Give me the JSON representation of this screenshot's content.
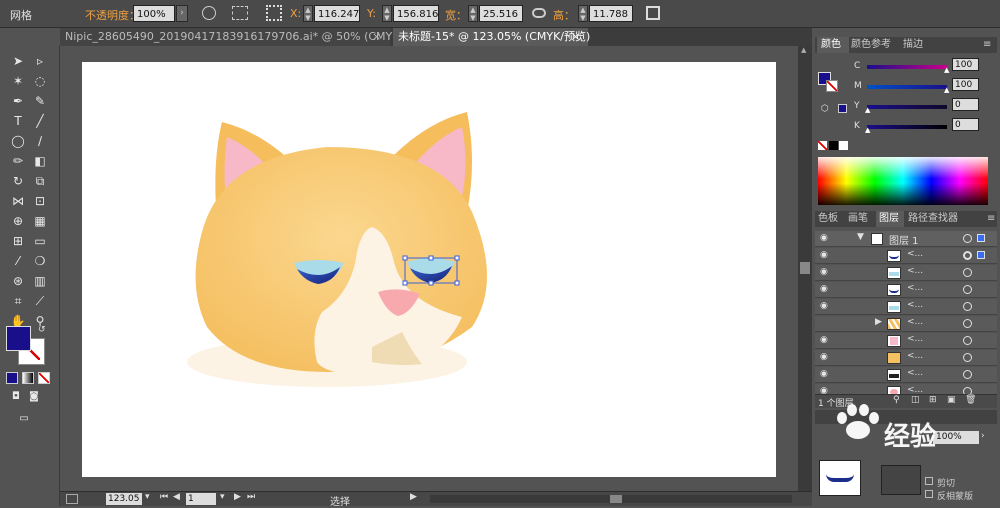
{
  "control_bar": {
    "mode_label": "网格",
    "opacity_label": "不透明度：",
    "opacity_value": "100%",
    "x_label": "X:",
    "x_value": "116.247",
    "y_label": "Y:",
    "y_value": "156.816",
    "w_label": "宽：",
    "w_value": "25.516",
    "h_label": "高：",
    "h_value": "11.788"
  },
  "tabs": [
    {
      "label": "Nipic_28605490_20190417183916179706.ai* @ 50% (CMYK/预览)",
      "active": false
    },
    {
      "label": "未标题-15* @ 123.05% (CMYK/预览)",
      "active": true
    }
  ],
  "color_panel": {
    "tabs": [
      "颜色",
      "颜色参考",
      "描边"
    ],
    "channels": [
      {
        "name": "C",
        "value": "100"
      },
      {
        "name": "M",
        "value": "100"
      },
      {
        "name": "Y",
        "value": "0"
      },
      {
        "name": "K",
        "value": "0"
      }
    ]
  },
  "layers_panel": {
    "tabs": [
      "色板",
      "画笔",
      "图层",
      "路径查找器"
    ],
    "layer_name": "图层 1",
    "sublayer_label": "<...",
    "footer_count": "1 个图层"
  },
  "transparency_panel": {
    "opacity_value": "100%",
    "clip_label": "剪切",
    "invert_label": "反相蒙版"
  },
  "status_bar": {
    "zoom": "123.05",
    "page": "1",
    "tool": "选择"
  },
  "watermark": {
    "text": "经验"
  },
  "colors": {
    "fill": "#1a0f8a",
    "fur": "#f5c062",
    "muzzle": "#fdf3e5",
    "ear_inner": "#f7b8c8",
    "nose": "#f7a9ad",
    "eye_blue": "#1d2d8a"
  }
}
